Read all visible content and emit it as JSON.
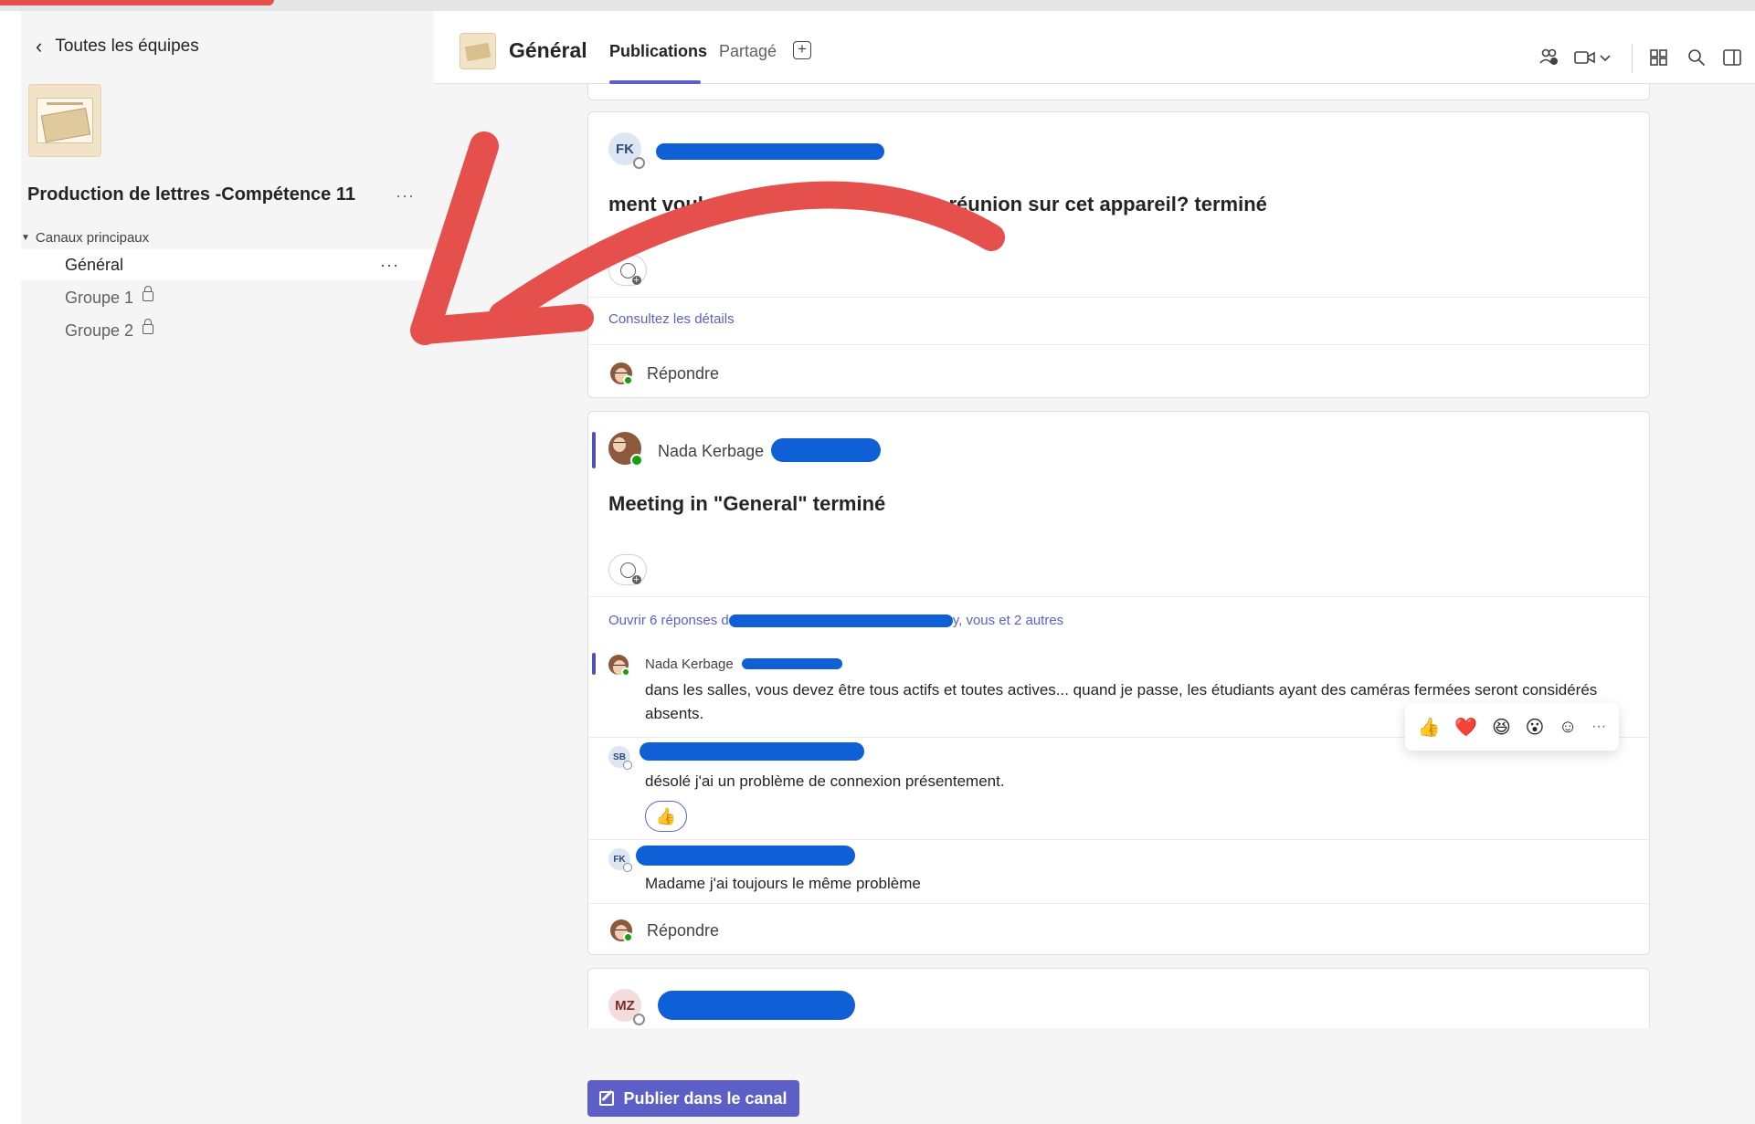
{
  "sidebar": {
    "back_label": "Toutes les équipes",
    "team_name": "Production de lettres -Compétence 11",
    "more_label": "···",
    "section_label": "Canaux principaux",
    "channels": [
      {
        "label": "Général",
        "more": "···"
      },
      {
        "label": "Groupe 1"
      },
      {
        "label": "Groupe 2"
      }
    ]
  },
  "header": {
    "channel_title": "Général",
    "tabs": [
      {
        "label": "Publications"
      },
      {
        "label": "Partagé"
      }
    ],
    "add_tab": "+"
  },
  "posts": [
    {
      "initials": "FK",
      "title": "ment voulez-vous",
      "title_rest": "la réunion sur cet appareil? terminé",
      "details_link": "Consultez les détails",
      "reply_label": "Répondre"
    },
    {
      "author": "Nada Kerbage",
      "title": "Meeting in \"General\" terminé",
      "replies_link_start": "Ouvrir 6 réponses d",
      "replies_link_end": "y, vous et 2 autres",
      "replies": [
        {
          "author": "Nada Kerbage",
          "text": "dans les salles, vous devez être tous actifs et toutes actives... quand je passe, les étudiants ayant des caméras fermées seront considérés absents."
        },
        {
          "initials": "SB",
          "text": "désolé j'ai un problème de connexion présentement.",
          "reaction": "👍"
        },
        {
          "initials": "FK",
          "text": "Madame j'ai toujours le même problème"
        }
      ],
      "reply_label": "Répondre"
    },
    {
      "initials": "MZ"
    }
  ],
  "reaction_bar": {
    "items": [
      "👍",
      "❤️",
      "😆",
      "😮",
      "☺",
      "···"
    ]
  },
  "publish_button": "Publier dans le canal",
  "colors": {
    "accent": "#5b5fc7",
    "arrow": "#e5504d",
    "redaction": "#0f5fd6"
  }
}
